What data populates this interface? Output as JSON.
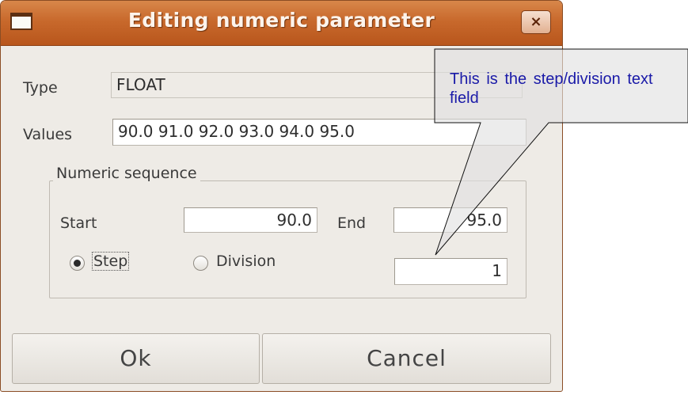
{
  "window": {
    "title": "Editing numeric parameter",
    "close_glyph": "×"
  },
  "form": {
    "type_label": "Type",
    "type_value": "FLOAT",
    "values_label": "Values",
    "values_value": "90.0 91.0 92.0 93.0 94.0 95.0"
  },
  "sequence": {
    "group_title": "Numeric sequence",
    "start_label": "Start",
    "start_value": "90.0",
    "end_label": "End",
    "end_value": "95.0",
    "step_label": "Step",
    "division_label": "Division",
    "selected_mode": "Step",
    "step_value": "1"
  },
  "buttons": {
    "ok_label": "Ok",
    "cancel_label": "Cancel"
  },
  "callout": {
    "text": "This is the step/division text field"
  },
  "colors": {
    "titlebar": "#c8692c",
    "dialog_bg": "#eeebe6",
    "callout_fill": "#e0e0e0",
    "callout_text": "#1a1aa8"
  }
}
